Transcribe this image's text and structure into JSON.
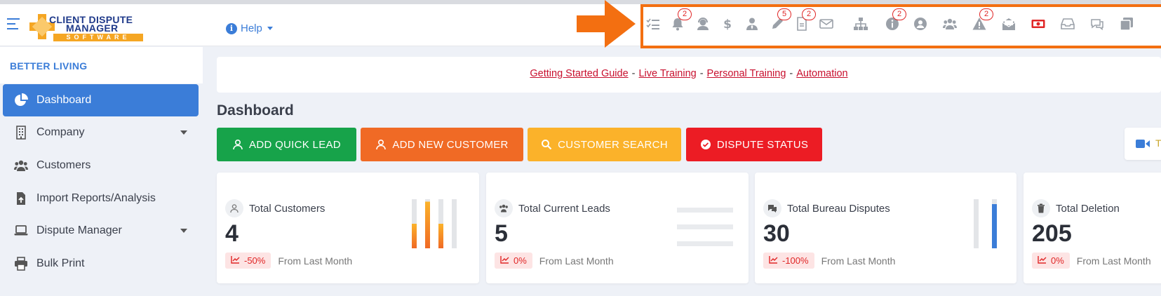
{
  "brand": {
    "line1": "CLIENT DISPUTE",
    "line2": "MANAGER",
    "line3": "SOFTWARE"
  },
  "header": {
    "help_label": "Help",
    "notifications": [
      {
        "icon": "checklist-icon",
        "badge": ""
      },
      {
        "icon": "bell-icon",
        "badge": "2"
      },
      {
        "icon": "support-agent-icon",
        "badge": ""
      },
      {
        "icon": "dollar-icon",
        "badge": ""
      },
      {
        "icon": "user-tie-icon",
        "badge": ""
      },
      {
        "icon": "pen-icon",
        "badge": "5"
      },
      {
        "icon": "document-icon",
        "badge": "2"
      },
      {
        "icon": "envelope-icon",
        "badge": ""
      },
      {
        "icon": "org-chart-icon",
        "badge": ""
      },
      {
        "icon": "info-icon",
        "badge": "2"
      },
      {
        "icon": "globe-user-icon",
        "badge": ""
      },
      {
        "icon": "users-icon",
        "badge": ""
      },
      {
        "icon": "warning-icon",
        "badge": "2"
      },
      {
        "icon": "open-mail-icon",
        "badge": ""
      },
      {
        "icon": "money-icon",
        "badge": ""
      },
      {
        "icon": "inbox-icon",
        "badge": ""
      },
      {
        "icon": "chat-icon",
        "badge": ""
      },
      {
        "icon": "copy-icon",
        "badge": ""
      }
    ]
  },
  "sidebar": {
    "company": "BETTER LIVING",
    "items": [
      {
        "label": "Dashboard",
        "icon": "pie-chart-icon",
        "active": true,
        "caret": false
      },
      {
        "label": "Company",
        "icon": "building-icon",
        "active": false,
        "caret": true
      },
      {
        "label": "Customers",
        "icon": "users-icon",
        "active": false,
        "caret": false
      },
      {
        "label": "Import Reports/Analysis",
        "icon": "file-import-icon",
        "active": false,
        "caret": false
      },
      {
        "label": "Dispute Manager",
        "icon": "laptop-icon",
        "active": false,
        "caret": true
      },
      {
        "label": "Bulk Print",
        "icon": "printer-icon",
        "active": false,
        "caret": false
      }
    ]
  },
  "links": {
    "getting_started": "Getting Started Guide",
    "live_training": "Live Training",
    "personal_training": "Personal Training",
    "automation": "Automation",
    "separator": "-"
  },
  "main": {
    "title": "Dashboard",
    "buttons": {
      "add_quick_lead": "ADD QUICK LEAD",
      "add_new_customer": "ADD NEW CUSTOMER",
      "customer_search": "CUSTOMER SEARCH",
      "dispute_status": "DISPUTE STATUS"
    },
    "video_label": "T"
  },
  "cards": [
    {
      "title": "Total Customers",
      "value": "4",
      "change": "-50%",
      "from": "From Last Month",
      "bars": [
        0.5,
        0.95,
        0.5,
        0.0
      ]
    },
    {
      "title": "Total Current Leads",
      "value": "5",
      "change": "0%",
      "from": "From Last Month"
    },
    {
      "title": "Total Bureau Disputes",
      "value": "30",
      "change": "-100%",
      "from": "From Last Month",
      "bars": [
        0.0,
        0.9
      ]
    },
    {
      "title": "Total Deletion",
      "value": "205",
      "change": "0%",
      "from": "From Last Month"
    }
  ],
  "colors": {
    "primary": "#3b7dd8",
    "accent_orange": "#f36f11",
    "badge_red": "#e02626",
    "green": "#17a34a",
    "orange": "#f06a25",
    "yellow": "#fbb22a",
    "red": "#ec1c24"
  }
}
